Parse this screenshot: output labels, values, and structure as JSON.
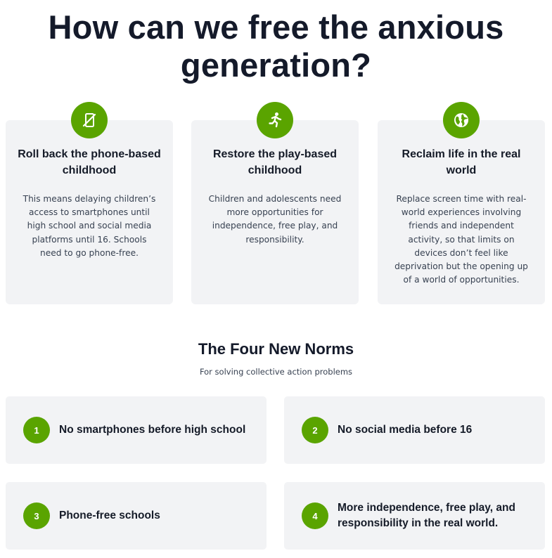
{
  "hero": {
    "title_line1": "How can we free the anxious",
    "title_line2": "generation?"
  },
  "accent_color": "#5aa400",
  "pillars": [
    {
      "icon": "no-phone-icon",
      "title": "Roll back the phone-based childhood",
      "text": "This means delaying children’s access to smartphones until high school and social media platforms until 16. Schools need to go phone-free."
    },
    {
      "icon": "running-person-icon",
      "title": "Restore the play-based childhood",
      "text": "Children and adolescents need more opportunities for independence, free play, and responsibility."
    },
    {
      "icon": "globe-icon",
      "title": "Reclaim life in the real world",
      "text": "Replace screen time with real-world experiences involving friends and independent activity, so that limits on devices don’t feel like deprivation but the opening up of a world of opportunities."
    }
  ],
  "norms": {
    "title": "The Four New Norms",
    "subtitle": "For solving collective action problems",
    "items": [
      {
        "number": "1",
        "text": "No smartphones before high school"
      },
      {
        "number": "2",
        "text": "No social media before 16"
      },
      {
        "number": "3",
        "text": "Phone-free schools"
      },
      {
        "number": "4",
        "text": "More independence, free play, and responsibility in the real world."
      }
    ]
  }
}
